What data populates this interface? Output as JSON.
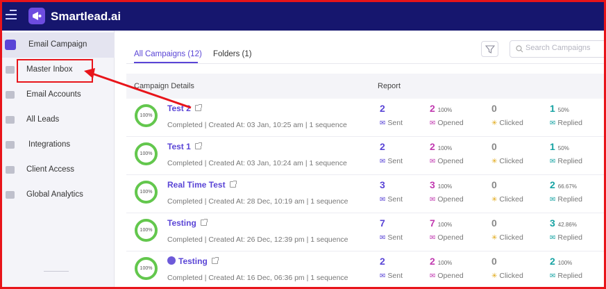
{
  "brand": {
    "name": "Smartlead.ai"
  },
  "sidebar": {
    "items": [
      {
        "label": "Email Campaign",
        "icon": "megaphone-icon",
        "active": true
      },
      {
        "label": "Master Inbox",
        "icon": "inbox-icon"
      },
      {
        "label": "Email Accounts",
        "icon": "envelope-icon"
      },
      {
        "label": "All Leads",
        "icon": "leads-icon"
      },
      {
        "label": "Integrations",
        "icon": "puzzle-icon"
      },
      {
        "label": "Client Access",
        "icon": "bolt-icon"
      },
      {
        "label": "Global Analytics",
        "icon": "bar-chart-icon"
      }
    ]
  },
  "tabs": [
    {
      "label": "All Campaigns (12)"
    },
    {
      "label": "Folders (1)"
    }
  ],
  "search": {
    "placeholder": "Search Campaigns"
  },
  "table": {
    "headers": {
      "details": "Campaign Details",
      "report": "Report"
    },
    "labels": {
      "sent": "Sent",
      "opened": "Opened",
      "clicked": "Clicked",
      "replied": "Replied"
    },
    "rows": [
      {
        "progress": "100%",
        "name": "Test 2",
        "status": "Completed | Created At: 03 Jan, 10:25 am | 1 sequence",
        "sent": "2",
        "opened": "2",
        "opened_pct": "100%",
        "clicked": "0",
        "replied": "1",
        "replied_pct": "50%"
      },
      {
        "progress": "100%",
        "name": "Test 1",
        "status": "Completed | Created At: 03 Jan, 10:24 am | 1 sequence",
        "sent": "2",
        "opened": "2",
        "opened_pct": "100%",
        "clicked": "0",
        "replied": "1",
        "replied_pct": "50%"
      },
      {
        "progress": "100%",
        "name": "Real Time Test",
        "status": "Completed | Created At: 28 Dec, 10:19 am | 1 sequence",
        "sent": "3",
        "opened": "3",
        "opened_pct": "100%",
        "clicked": "0",
        "replied": "2",
        "replied_pct": "66.67%"
      },
      {
        "progress": "100%",
        "name": "Testing",
        "status": "Completed | Created At: 26 Dec, 12:39 pm | 1 sequence",
        "sent": "7",
        "opened": "7",
        "opened_pct": "100%",
        "clicked": "0",
        "replied": "3",
        "replied_pct": "42.86%"
      },
      {
        "progress": "100%",
        "name": "Testing",
        "status": "Completed | Created At: 16 Dec, 06:36 pm | 1 sequence",
        "sent": "2",
        "opened": "2",
        "opened_pct": "100%",
        "clicked": "0",
        "replied": "2",
        "replied_pct": "100%"
      }
    ]
  },
  "colors": {
    "topbar": "#16166e",
    "accent": "#5a45d6",
    "highlight": "#e8141a",
    "ring": "#63c74d"
  }
}
